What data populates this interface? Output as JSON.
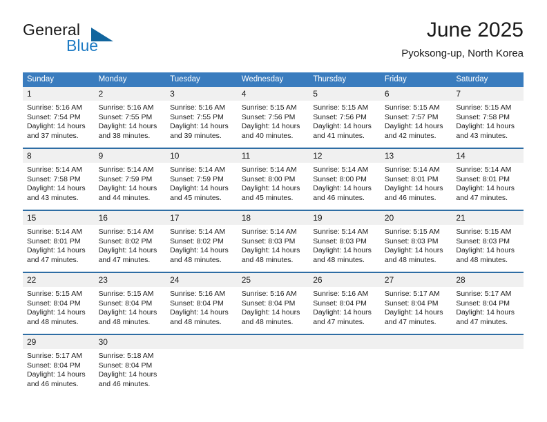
{
  "brand": {
    "name_part1": "General",
    "name_part2": "Blue",
    "triangle_icon": "triangle-icon",
    "accent_color": "#1e7bc4",
    "triangle_color": "#11659e"
  },
  "header": {
    "month_title": "June 2025",
    "location": "Pyoksong-up, North Korea"
  },
  "calendar": {
    "header_bg": "#3a7cbe",
    "header_text_color": "#ffffff",
    "row_divider_color": "#2e6da4",
    "daynum_bg": "#f0f0f0",
    "weekday_headers": [
      "Sunday",
      "Monday",
      "Tuesday",
      "Wednesday",
      "Thursday",
      "Friday",
      "Saturday"
    ],
    "weeks": [
      [
        {
          "day": "1",
          "sunrise": "Sunrise: 5:16 AM",
          "sunset": "Sunset: 7:54 PM",
          "daylight_line1": "Daylight: 14 hours",
          "daylight_line2": "and 37 minutes."
        },
        {
          "day": "2",
          "sunrise": "Sunrise: 5:16 AM",
          "sunset": "Sunset: 7:55 PM",
          "daylight_line1": "Daylight: 14 hours",
          "daylight_line2": "and 38 minutes."
        },
        {
          "day": "3",
          "sunrise": "Sunrise: 5:16 AM",
          "sunset": "Sunset: 7:55 PM",
          "daylight_line1": "Daylight: 14 hours",
          "daylight_line2": "and 39 minutes."
        },
        {
          "day": "4",
          "sunrise": "Sunrise: 5:15 AM",
          "sunset": "Sunset: 7:56 PM",
          "daylight_line1": "Daylight: 14 hours",
          "daylight_line2": "and 40 minutes."
        },
        {
          "day": "5",
          "sunrise": "Sunrise: 5:15 AM",
          "sunset": "Sunset: 7:56 PM",
          "daylight_line1": "Daylight: 14 hours",
          "daylight_line2": "and 41 minutes."
        },
        {
          "day": "6",
          "sunrise": "Sunrise: 5:15 AM",
          "sunset": "Sunset: 7:57 PM",
          "daylight_line1": "Daylight: 14 hours",
          "daylight_line2": "and 42 minutes."
        },
        {
          "day": "7",
          "sunrise": "Sunrise: 5:15 AM",
          "sunset": "Sunset: 7:58 PM",
          "daylight_line1": "Daylight: 14 hours",
          "daylight_line2": "and 43 minutes."
        }
      ],
      [
        {
          "day": "8",
          "sunrise": "Sunrise: 5:14 AM",
          "sunset": "Sunset: 7:58 PM",
          "daylight_line1": "Daylight: 14 hours",
          "daylight_line2": "and 43 minutes."
        },
        {
          "day": "9",
          "sunrise": "Sunrise: 5:14 AM",
          "sunset": "Sunset: 7:59 PM",
          "daylight_line1": "Daylight: 14 hours",
          "daylight_line2": "and 44 minutes."
        },
        {
          "day": "10",
          "sunrise": "Sunrise: 5:14 AM",
          "sunset": "Sunset: 7:59 PM",
          "daylight_line1": "Daylight: 14 hours",
          "daylight_line2": "and 45 minutes."
        },
        {
          "day": "11",
          "sunrise": "Sunrise: 5:14 AM",
          "sunset": "Sunset: 8:00 PM",
          "daylight_line1": "Daylight: 14 hours",
          "daylight_line2": "and 45 minutes."
        },
        {
          "day": "12",
          "sunrise": "Sunrise: 5:14 AM",
          "sunset": "Sunset: 8:00 PM",
          "daylight_line1": "Daylight: 14 hours",
          "daylight_line2": "and 46 minutes."
        },
        {
          "day": "13",
          "sunrise": "Sunrise: 5:14 AM",
          "sunset": "Sunset: 8:01 PM",
          "daylight_line1": "Daylight: 14 hours",
          "daylight_line2": "and 46 minutes."
        },
        {
          "day": "14",
          "sunrise": "Sunrise: 5:14 AM",
          "sunset": "Sunset: 8:01 PM",
          "daylight_line1": "Daylight: 14 hours",
          "daylight_line2": "and 47 minutes."
        }
      ],
      [
        {
          "day": "15",
          "sunrise": "Sunrise: 5:14 AM",
          "sunset": "Sunset: 8:01 PM",
          "daylight_line1": "Daylight: 14 hours",
          "daylight_line2": "and 47 minutes."
        },
        {
          "day": "16",
          "sunrise": "Sunrise: 5:14 AM",
          "sunset": "Sunset: 8:02 PM",
          "daylight_line1": "Daylight: 14 hours",
          "daylight_line2": "and 47 minutes."
        },
        {
          "day": "17",
          "sunrise": "Sunrise: 5:14 AM",
          "sunset": "Sunset: 8:02 PM",
          "daylight_line1": "Daylight: 14 hours",
          "daylight_line2": "and 48 minutes."
        },
        {
          "day": "18",
          "sunrise": "Sunrise: 5:14 AM",
          "sunset": "Sunset: 8:03 PM",
          "daylight_line1": "Daylight: 14 hours",
          "daylight_line2": "and 48 minutes."
        },
        {
          "day": "19",
          "sunrise": "Sunrise: 5:14 AM",
          "sunset": "Sunset: 8:03 PM",
          "daylight_line1": "Daylight: 14 hours",
          "daylight_line2": "and 48 minutes."
        },
        {
          "day": "20",
          "sunrise": "Sunrise: 5:15 AM",
          "sunset": "Sunset: 8:03 PM",
          "daylight_line1": "Daylight: 14 hours",
          "daylight_line2": "and 48 minutes."
        },
        {
          "day": "21",
          "sunrise": "Sunrise: 5:15 AM",
          "sunset": "Sunset: 8:03 PM",
          "daylight_line1": "Daylight: 14 hours",
          "daylight_line2": "and 48 minutes."
        }
      ],
      [
        {
          "day": "22",
          "sunrise": "Sunrise: 5:15 AM",
          "sunset": "Sunset: 8:04 PM",
          "daylight_line1": "Daylight: 14 hours",
          "daylight_line2": "and 48 minutes."
        },
        {
          "day": "23",
          "sunrise": "Sunrise: 5:15 AM",
          "sunset": "Sunset: 8:04 PM",
          "daylight_line1": "Daylight: 14 hours",
          "daylight_line2": "and 48 minutes."
        },
        {
          "day": "24",
          "sunrise": "Sunrise: 5:16 AM",
          "sunset": "Sunset: 8:04 PM",
          "daylight_line1": "Daylight: 14 hours",
          "daylight_line2": "and 48 minutes."
        },
        {
          "day": "25",
          "sunrise": "Sunrise: 5:16 AM",
          "sunset": "Sunset: 8:04 PM",
          "daylight_line1": "Daylight: 14 hours",
          "daylight_line2": "and 48 minutes."
        },
        {
          "day": "26",
          "sunrise": "Sunrise: 5:16 AM",
          "sunset": "Sunset: 8:04 PM",
          "daylight_line1": "Daylight: 14 hours",
          "daylight_line2": "and 47 minutes."
        },
        {
          "day": "27",
          "sunrise": "Sunrise: 5:17 AM",
          "sunset": "Sunset: 8:04 PM",
          "daylight_line1": "Daylight: 14 hours",
          "daylight_line2": "and 47 minutes."
        },
        {
          "day": "28",
          "sunrise": "Sunrise: 5:17 AM",
          "sunset": "Sunset: 8:04 PM",
          "daylight_line1": "Daylight: 14 hours",
          "daylight_line2": "and 47 minutes."
        }
      ],
      [
        {
          "day": "29",
          "sunrise": "Sunrise: 5:17 AM",
          "sunset": "Sunset: 8:04 PM",
          "daylight_line1": "Daylight: 14 hours",
          "daylight_line2": "and 46 minutes."
        },
        {
          "day": "30",
          "sunrise": "Sunrise: 5:18 AM",
          "sunset": "Sunset: 8:04 PM",
          "daylight_line1": "Daylight: 14 hours",
          "daylight_line2": "and 46 minutes."
        },
        {
          "day": "",
          "sunrise": "",
          "sunset": "",
          "daylight_line1": "",
          "daylight_line2": ""
        },
        {
          "day": "",
          "sunrise": "",
          "sunset": "",
          "daylight_line1": "",
          "daylight_line2": ""
        },
        {
          "day": "",
          "sunrise": "",
          "sunset": "",
          "daylight_line1": "",
          "daylight_line2": ""
        },
        {
          "day": "",
          "sunrise": "",
          "sunset": "",
          "daylight_line1": "",
          "daylight_line2": ""
        },
        {
          "day": "",
          "sunrise": "",
          "sunset": "",
          "daylight_line1": "",
          "daylight_line2": ""
        }
      ]
    ]
  }
}
